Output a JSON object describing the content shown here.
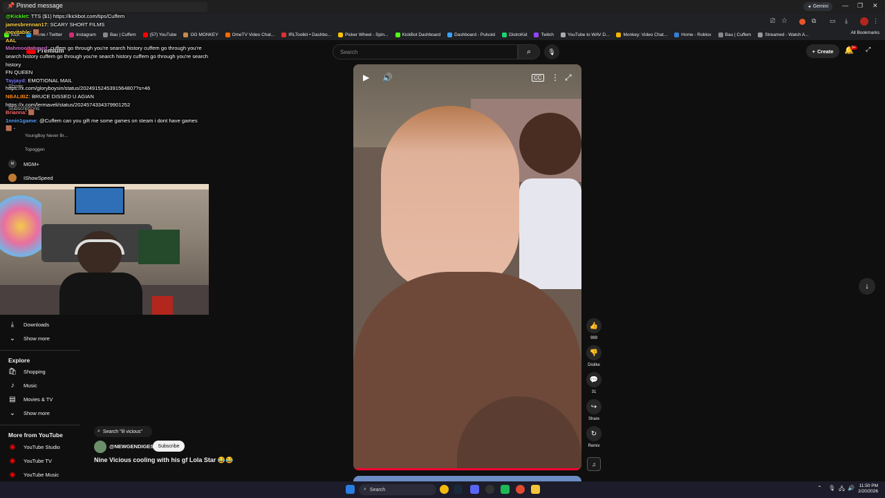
{
  "browser": {
    "gemini_label": "Gemini",
    "bookmarks": [
      {
        "label": "Kick",
        "color": "#53fc18"
      },
      {
        "label": "Home / Twitter",
        "color": "#1d9bf0"
      },
      {
        "label": "Instagram",
        "color": "#d62976"
      },
      {
        "label": "Bau | Cuffem",
        "color": "#888888"
      },
      {
        "label": "(57) YouTube",
        "color": "#ff0000"
      },
      {
        "label": "OG MONKEY",
        "color": "#c58b4a"
      },
      {
        "label": "OmeTV Video Chat...",
        "color": "#ff6a00"
      },
      {
        "label": "IRLToolkit • Dashbo...",
        "color": "#e03030"
      },
      {
        "label": "Picker Wheel - Spin...",
        "color": "#f4c20d"
      },
      {
        "label": "KickBot Dashboard",
        "color": "#53fc18"
      },
      {
        "label": "Dashboard - Pulsoid",
        "color": "#3aa0ff"
      },
      {
        "label": "DistroKid",
        "color": "#19d36e"
      },
      {
        "label": "Twitch",
        "color": "#9146ff"
      },
      {
        "label": "YouTube to WAV D...",
        "color": "#aaaaaa"
      },
      {
        "label": "Monkey: Video Chat...",
        "color": "#f0b400"
      },
      {
        "label": "Home - Roblox",
        "color": "#3a7bd5"
      },
      {
        "label": "Bau | Cuffem",
        "color": "#888888"
      },
      {
        "label": "Streamed - Watch A...",
        "color": "#999999"
      }
    ],
    "all_bookmarks": "All Bookmarks"
  },
  "youtube": {
    "logo_text": "Premium",
    "search_placeholder": "Search",
    "create_label": "Create",
    "bell_badge": "9+"
  },
  "chat": {
    "pinned": "Pinned message",
    "lines": [
      {
        "user": "@Kicklet:",
        "text": " TTS ($1) https://kickbot.com/tips/Cuffem",
        "color": "#53fc18"
      },
      {
        "user": "jamesbrennan17:",
        "text": "  SCARY SHORT FILMS",
        "color": "#ffd54a"
      },
      {
        "user": "inevitable:",
        "text": " 🟫",
        "color": "#ffd54a"
      },
      {
        "user": "AAL",
        "text": "",
        "color": "#ffd54a"
      },
      {
        "user": "Mahmooitahmed:",
        "text": "  cuffem go through you're search history cuffem go through you're search history cuffem go through you're search history cuffem go through you're search history",
        "color": "#c86bc8"
      },
      {
        "user": "",
        "text": "FN QUEEN",
        "color": "#ffffff"
      },
      {
        "user": "Tayjayd:",
        "text": "  EMOTIONAL MAIL",
        "color": "#7a7aff"
      },
      {
        "user": "",
        "text": "https://x.com/gloryboysin/status/2024915245391564807?s=46",
        "color": "#ffffff"
      },
      {
        "user": "NBALIBZ:",
        "text": "  BRUCE DISSED U AGIAN",
        "color": "#ff8c1a"
      },
      {
        "user": "",
        "text": "https://x.com/lermaveli/status/2024574334379901252",
        "color": "#ffffff"
      },
      {
        "user": "Brianna:",
        "text": " 🟫",
        "color": "#ff6a6a"
      },
      {
        "user": "1nnin1game:",
        "text": " @Cuffem can you gift me some games on steam i dont have games",
        "color": "#5aa0ff"
      },
      {
        "user": "",
        "text": "🟫 -",
        "color": "#ffffff"
      }
    ]
  },
  "sidebar": {
    "faded": [
      {
        "label": "Shorts"
      },
      {
        "label": "Subscriptions"
      },
      {
        "label": "YoungBoy Never Br..."
      },
      {
        "label": "Topoggen"
      }
    ],
    "subs": [
      {
        "label": "MGM+",
        "icon": "mgm-icon"
      },
      {
        "label": "IShowSpeed",
        "icon": "avatar-icon"
      }
    ],
    "you": [
      {
        "label": "Downloads",
        "icon": "download-icon"
      },
      {
        "label": "Show more",
        "icon": "chevron-down-icon"
      }
    ],
    "explore_head": "Explore",
    "explore": [
      {
        "label": "Shopping",
        "icon": "bag-icon"
      },
      {
        "label": "Music",
        "icon": "music-icon"
      },
      {
        "label": "Movies & TV",
        "icon": "film-icon"
      },
      {
        "label": "Show more",
        "icon": "chevron-down-icon"
      }
    ],
    "more_head": "More from YouTube",
    "more": [
      {
        "label": "YouTube Studio"
      },
      {
        "label": "YouTube TV"
      },
      {
        "label": "YouTube Music"
      }
    ]
  },
  "short": {
    "search_chip": "Search \"lil vicious\"",
    "channel": "@NEWGENDIGEST",
    "subscribe": "Subscribe",
    "title": "Nine Vicious cooling with his gf Lola Star 😂😂",
    "likes": "989",
    "dislike": "Dislike",
    "comments": "31",
    "share": "Share",
    "remix": "Remix"
  },
  "taskbar": {
    "search": "Search",
    "time": "11:50 PM",
    "date": "2/20/2026"
  }
}
